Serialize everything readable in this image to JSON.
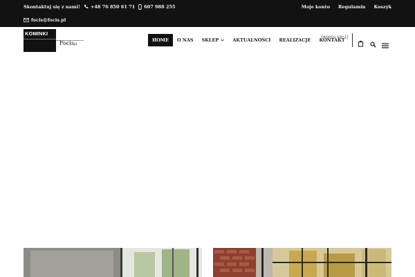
{
  "topbar": {
    "contact_label": "Skontaktuj się z nami!",
    "phone_label": "+48 76 850 61 71",
    "mobile_label": "607 988 255",
    "email_label": "focis@focis.pl",
    "links": [
      "Moje konto",
      "Regulamin",
      "Koszyk"
    ]
  },
  "logo": {
    "main_text": "KOMINKI",
    "sub_text": "Focis",
    "sub_suffix": "pl"
  },
  "nav": {
    "items": [
      "HOME",
      "O NAS",
      "SKLEP",
      "AKTUALNOŚCI",
      "REALIZACJE",
      "KONTAKT"
    ],
    "active_index": 0
  },
  "woocs_shortcode": "[woocs sd=1]",
  "icons": [
    "phone-icon",
    "mobile-icon",
    "mail-icon",
    "cart-icon",
    "search-icon",
    "menu-icon",
    "chevron-down-icon"
  ],
  "colors": {
    "topbar_bg": "#121212",
    "active_nav_bg": "#111111",
    "page_bg": "#ffffff"
  }
}
